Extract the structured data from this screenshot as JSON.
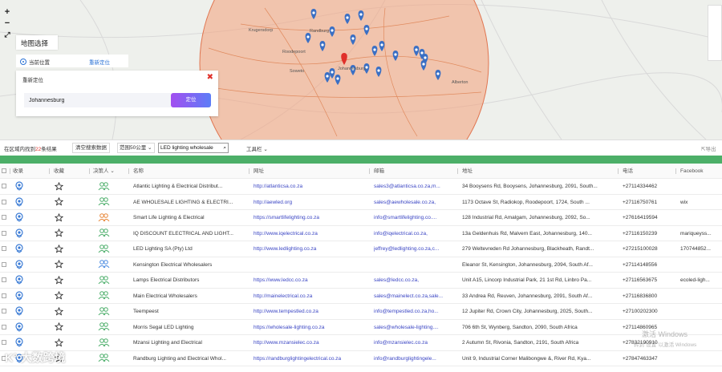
{
  "map": {
    "zoom_in": "+",
    "zoom_out": "−",
    "fullscreen": "⤢",
    "select_title": "地图选择",
    "current_location": "当前位置",
    "relocate": "重新定位",
    "panel_title": "重新定位",
    "panel_close": "✖",
    "input_value": "Johannesburg",
    "confirm": "定位",
    "labels": [
      "Krugersdorp",
      "Randburg",
      "Roodepoort",
      "Soweto",
      "Johannesburg",
      "Alberton"
    ],
    "accent_color": "#f4a07a"
  },
  "toolbar": {
    "result_prefix": "在区域内找到",
    "result_count": "22",
    "result_suffix": "条结果",
    "clear": "清空搜索数据",
    "range": "范围50公里",
    "search_value": "LED lighting wholesale",
    "tools": "工具栏",
    "export": "导出"
  },
  "table": {
    "headers": [
      "",
      "收录",
      "收藏",
      "决策人",
      "名称",
      "网址",
      "邮箱",
      "地址",
      "电话",
      "Facebook"
    ],
    "rows": [
      {
        "name": "Atlantic Lighting & Electrical Distribut...",
        "url": "http://atlanticsa.co.za",
        "email": "sales3@atlanticsa.co.za,m...",
        "address": "34 Booysens Rd, Booysens, Johannesburg, 2091, South...",
        "phone": "+27114334462",
        "facebook": "",
        "dm": "green"
      },
      {
        "name": "AE WHOLESALE LIGHTING & ELECTRI...",
        "url": "http://aewled.org",
        "email": "sales@aewholesale.co.za,",
        "address": "1173 Octave St, Radiokop, Roodepoort, 1724, South ...",
        "phone": "+27116750761",
        "facebook": "wix",
        "dm": "green"
      },
      {
        "name": "Smart Life Lighting & Electrical",
        "url": "https://smartlifelighting.co.za",
        "email": "info@smartlifelighting.co....",
        "address": "128 Industrial Rd, Amalgam, Johannesburg, 2092, So...",
        "phone": "+27616419594",
        "facebook": "",
        "dm": "orange"
      },
      {
        "name": "IQ DISCOUNT ELECTRICAL AND LIGHT...",
        "url": "http://www.iqelectrical.co.za",
        "email": "info@iqelectrical.co.za,",
        "address": "13a Geldenhuis Rd, Malvern East, Johannesburg, 140...",
        "phone": "+27116150239",
        "facebook": "mariqueyss...",
        "dm": "green"
      },
      {
        "name": "LED Lighting SA (Pty) Ltd",
        "url": "http://www.ledlighting.co.za",
        "email": "jeffrey@ledlighting.co.za,c...",
        "address": "279 Weltevreden Rd Johannesburg, Blackheath, Randt...",
        "phone": "+27215100028",
        "facebook": "170744852...",
        "dm": "green"
      },
      {
        "name": "Kensington Electrical Wholesalers",
        "url": "",
        "email": "",
        "address": "Eleanor St, Kensington, Johannesburg, 2094, South Af...",
        "phone": "+27114148556",
        "facebook": "",
        "dm": "blue"
      },
      {
        "name": "Lamps Electrical Distributors",
        "url": "https://www.ledcc.co.za",
        "email": "sales@ledcc.co.za,",
        "address": "Unit A15, Lincorp Industrial Park, 21 1st Rd, Linbro Pa...",
        "phone": "+27116563675",
        "facebook": "ecoled-ligh...",
        "dm": "green"
      },
      {
        "name": "Main Electrical Wholesalers",
        "url": "http://mainelectrical.co.za",
        "email": "sales@mainelect.co.za,sale...",
        "address": "33 Andrea Rd, Reuven, Johannesburg, 2091, South Af...",
        "phone": "+27116836800",
        "facebook": "",
        "dm": "green"
      },
      {
        "name": "Teempeest",
        "url": "http://www.tempestled.co.za",
        "email": "info@tempestled.co.za,ho...",
        "address": "12 Jupiter Rd, Crown City, Johannesburg, 2025, South...",
        "phone": "+27100202300",
        "facebook": "",
        "dm": "green"
      },
      {
        "name": "Morris Segal LED Lighting",
        "url": "https://wholesale-lighting.co.za",
        "email": "sales@wholesale-lighting....",
        "address": "706 6th St, Wynberg, Sandton, 2090, South Africa",
        "phone": "+27114860965",
        "facebook": "",
        "dm": "green"
      },
      {
        "name": "Mzansi Lighting and Electrical",
        "url": "http://www.mzansielec.co.za",
        "email": "info@mzansielec.co.za",
        "address": "2 Autumn St, Rivonia, Sandton, 2191, South Africa",
        "phone": "+27832190910",
        "facebook": "",
        "dm": "green"
      },
      {
        "name": "Randburg Lighting and Electrical Whol...",
        "url": "https://randburglightingelectrical.co.za",
        "email": "info@randburglightingele...",
        "address": "Unit 9, Industrial Corner Malibongwe &, River Rd, Kya...",
        "phone": "+27847463347",
        "facebook": "",
        "dm": "green"
      }
    ]
  },
  "watermarks": {
    "activate": "激活 Windows",
    "activate_sub": "转到\"设置\"以激活 Windows",
    "logo": "大数跨境"
  }
}
